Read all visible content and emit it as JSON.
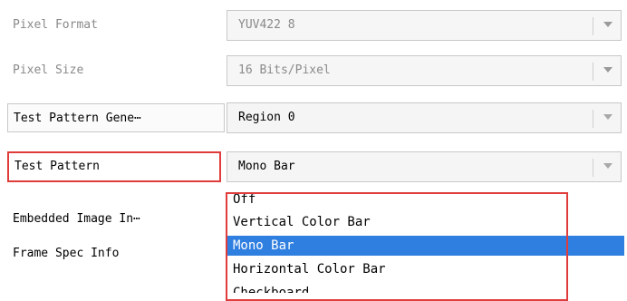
{
  "properties": [
    {
      "label": "Pixel Format",
      "value": "YUV422 8",
      "enabled": false
    },
    {
      "label": "Pixel Size",
      "value": "16 Bits/Pixel",
      "enabled": false
    },
    {
      "label": "Test Pattern Gene⋯",
      "value": "Region 0",
      "enabled": true
    },
    {
      "label": "Test Pattern",
      "value": "Mono Bar",
      "enabled": true
    },
    {
      "label": "Embedded Image In⋯"
    },
    {
      "label": "Frame Spec Info"
    }
  ],
  "dropdown": {
    "options": [
      "Off",
      "Vertical Color Bar",
      "Mono Bar",
      "Horizontal Color Bar",
      "Checkboard"
    ],
    "selected": "Mono Bar"
  },
  "colors": {
    "selection": "#2f7fe0",
    "highlight_border": "#e03c3c",
    "disabled_text": "#8a8a8a"
  },
  "icons": {
    "combo_arrow": "chevron-down-icon"
  }
}
